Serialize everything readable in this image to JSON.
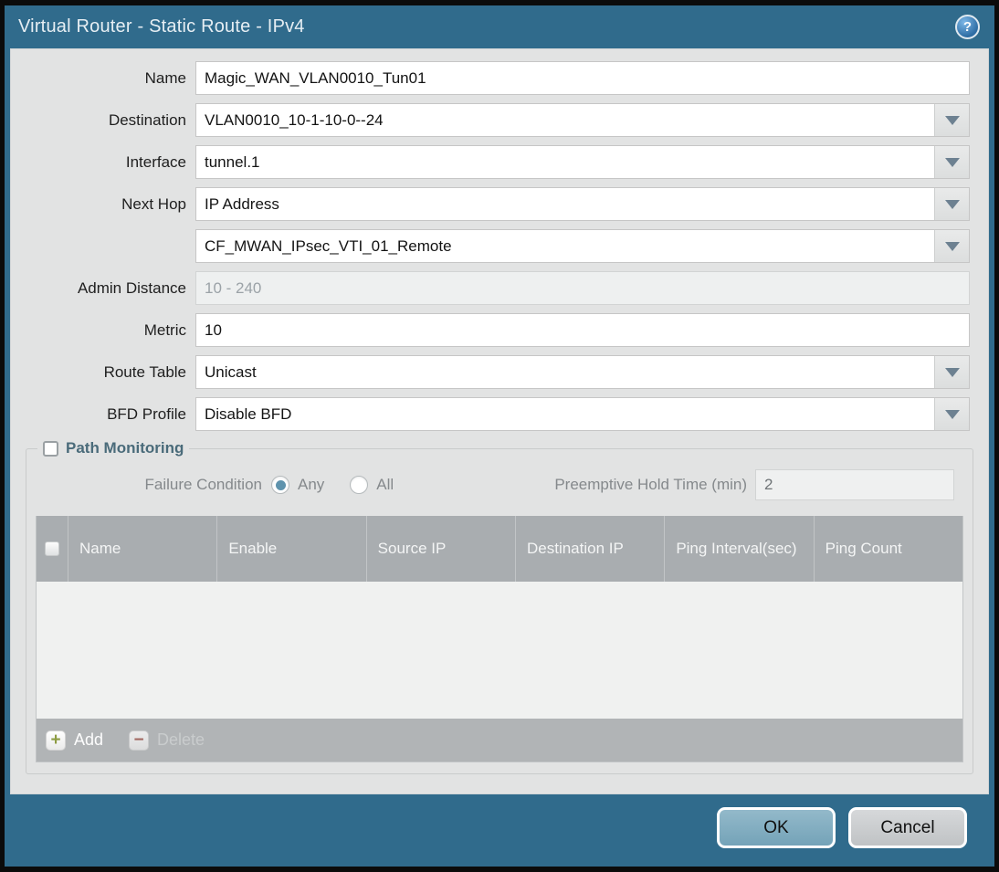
{
  "titlebar": {
    "title": "Virtual Router - Static Route - IPv4",
    "help_glyph": "?"
  },
  "form": {
    "name": {
      "label": "Name",
      "value": "Magic_WAN_VLAN0010_Tun01"
    },
    "destination": {
      "label": "Destination",
      "value": "VLAN0010_10-1-10-0--24"
    },
    "interface": {
      "label": "Interface",
      "value": "tunnel.1"
    },
    "next_hop": {
      "label": "Next Hop",
      "value": "IP Address"
    },
    "next_hop_address": {
      "value": "CF_MWAN_IPsec_VTI_01_Remote"
    },
    "admin_distance": {
      "label": "Admin Distance",
      "placeholder": "10 - 240",
      "value": ""
    },
    "metric": {
      "label": "Metric",
      "value": "10"
    },
    "route_table": {
      "label": "Route Table",
      "value": "Unicast"
    },
    "bfd_profile": {
      "label": "BFD Profile",
      "value": "Disable BFD"
    }
  },
  "path_monitoring": {
    "title": "Path Monitoring",
    "enabled": false,
    "failure_condition_label": "Failure Condition",
    "options": [
      {
        "label": "Any",
        "selected": true
      },
      {
        "label": "All",
        "selected": false
      }
    ],
    "preemptive_label": "Preemptive Hold Time (min)",
    "preemptive_value": "2",
    "table": {
      "columns": [
        "Name",
        "Enable",
        "Source IP",
        "Destination IP",
        "Ping Interval(sec)",
        "Ping Count"
      ],
      "rows": []
    },
    "add_label": "Add",
    "delete_label": "Delete",
    "add_glyph": "+",
    "delete_glyph": "−"
  },
  "actions": {
    "ok_label": "OK",
    "cancel_label": "Cancel"
  },
  "colors": {
    "frame_teal": "#306b8c",
    "panel_gray": "#e2e3e3",
    "table_header_gray": "#a9adb0",
    "radio_accent": "#5f93ad",
    "ok_button": "#74a3b8",
    "add_plus_green": "#8d9c43",
    "delete_minus_red": "#9c4f45"
  }
}
